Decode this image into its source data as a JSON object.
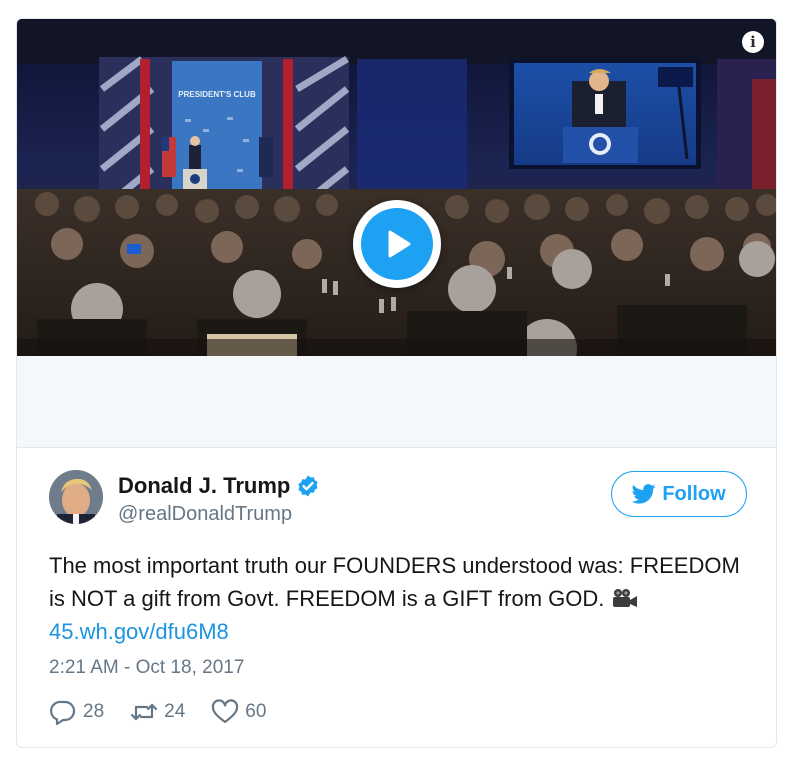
{
  "media": {
    "podium_screen_text": "PRESIDENT'S CLUB",
    "info_label": "i",
    "play_icon": "play-icon"
  },
  "author": {
    "display_name": "Donald J. Trump",
    "handle": "@realDonaldTrump",
    "verified": true
  },
  "follow": {
    "label": "Follow",
    "icon": "twitter-bird-icon"
  },
  "tweet": {
    "text": "The most important truth our FOUNDERS understood was: FREEDOM is NOT a gift from Govt. FREEDOM is a GIFT from GOD. ",
    "camera_icon": "movie-camera-icon",
    "link": "45.wh.gov/dfu6M8"
  },
  "timestamp": "2:21 AM - Oct 18, 2017",
  "actions": {
    "replies": "28",
    "retweets": "24",
    "likes": "60"
  },
  "colors": {
    "accent": "#1da1f2",
    "link": "#1b95e0",
    "muted": "#657786",
    "text": "#14171a"
  }
}
